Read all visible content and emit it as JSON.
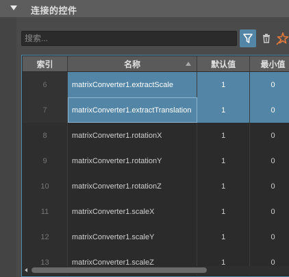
{
  "section": {
    "title": "连接的控件"
  },
  "search": {
    "placeholder": "搜索..."
  },
  "toolbar": {
    "filter_icon": "filter-icon",
    "delete_icon": "trash-icon",
    "pin_icon": "star-pin-icon"
  },
  "table": {
    "headers": {
      "index": "索引",
      "name": "名称",
      "default": "默认值",
      "min": "最小值"
    },
    "rows": [
      {
        "index": "6",
        "name": "matrixConverter1.extractScale",
        "default": "1",
        "min": "0"
      },
      {
        "index": "7",
        "name": "matrixConverter1.extractTranslation",
        "default": "1",
        "min": "0"
      },
      {
        "index": "8",
        "name": "matrixConverter1.rotationX",
        "default": "1",
        "min": "0"
      },
      {
        "index": "9",
        "name": "matrixConverter1.rotationY",
        "default": "1",
        "min": "0"
      },
      {
        "index": "10",
        "name": "matrixConverter1.rotationZ",
        "default": "1",
        "min": "0"
      },
      {
        "index": "11",
        "name": "matrixConverter1.scaleX",
        "default": "1",
        "min": "0"
      },
      {
        "index": "12",
        "name": "matrixConverter1.scaleY",
        "default": "1",
        "min": "0"
      },
      {
        "index": "13",
        "name": "matrixConverter1.scaleZ",
        "default": "1",
        "min": "0"
      }
    ]
  },
  "colors": {
    "selection": "#5285a6",
    "header_bg": "#5d5d5d",
    "table_bg": "#2b2b2b",
    "panel_bg": "#444444"
  }
}
